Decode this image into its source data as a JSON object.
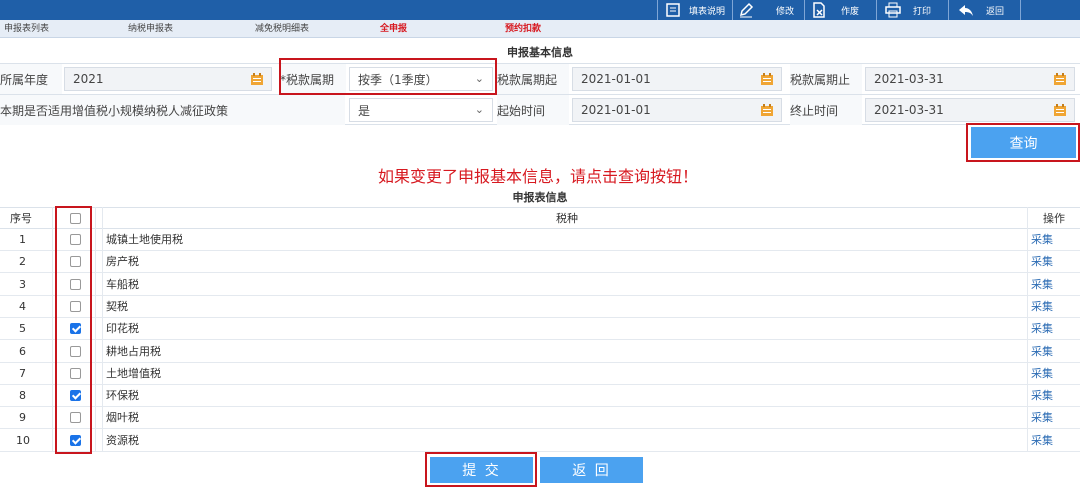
{
  "toolbar": {
    "fill_guide": "填表说明",
    "edit": "修改",
    "void": "作废",
    "print": "打印",
    "back": "返回"
  },
  "tabs": [
    "申报表列表",
    "纳税申报表",
    "减免税明细表",
    "全申报",
    "预约扣款"
  ],
  "basic_info": {
    "title": "申报基本信息",
    "tax_year_label": "所属年度",
    "tax_year": "2021",
    "period_type_label": "*税款属期",
    "period_type": "按季（1季度）",
    "period_start_label": "税款属期起",
    "period_start": "2021-01-01",
    "period_end_label": "税款属期止",
    "period_end": "2021-03-31",
    "policy_label": "本期是否适用增值税小规模纳税人减征政策",
    "policy_value": "是",
    "start_time_label": "起始时间",
    "start_time": "2021-01-01",
    "end_time_label": "终止时间",
    "end_time": "2021-03-31",
    "query_button": "查询"
  },
  "notice": "如果变更了申报基本信息，请点击查询按钮！",
  "table": {
    "title": "申报表信息",
    "headers": {
      "no": "序号",
      "tax": "税种",
      "op": "操作"
    },
    "rows": [
      {
        "no": "1",
        "tax": "城镇土地使用税",
        "checked": false,
        "op": "采集"
      },
      {
        "no": "2",
        "tax": "房产税",
        "checked": false,
        "op": "采集"
      },
      {
        "no": "3",
        "tax": "车船税",
        "checked": false,
        "op": "采集"
      },
      {
        "no": "4",
        "tax": "契税",
        "checked": false,
        "op": "采集"
      },
      {
        "no": "5",
        "tax": "印花税",
        "checked": true,
        "op": "采集"
      },
      {
        "no": "6",
        "tax": "耕地占用税",
        "checked": false,
        "op": "采集"
      },
      {
        "no": "7",
        "tax": "土地增值税",
        "checked": false,
        "op": "采集"
      },
      {
        "no": "8",
        "tax": "环保税",
        "checked": true,
        "op": "采集"
      },
      {
        "no": "9",
        "tax": "烟叶税",
        "checked": false,
        "op": "采集"
      },
      {
        "no": "10",
        "tax": "资源税",
        "checked": true,
        "op": "采集"
      }
    ]
  },
  "footer": {
    "submit": "提 交",
    "back": "返 回"
  },
  "colors": {
    "toolbar": "#1f5fa8",
    "button": "#4ba2f0",
    "highlight": "#c8151d",
    "notice": "#d71920"
  },
  "icons": [
    "fill-guide-icon",
    "edit-icon",
    "void-icon",
    "print-icon",
    "back-icon",
    "calendar-icon",
    "chevron-down-icon"
  ]
}
